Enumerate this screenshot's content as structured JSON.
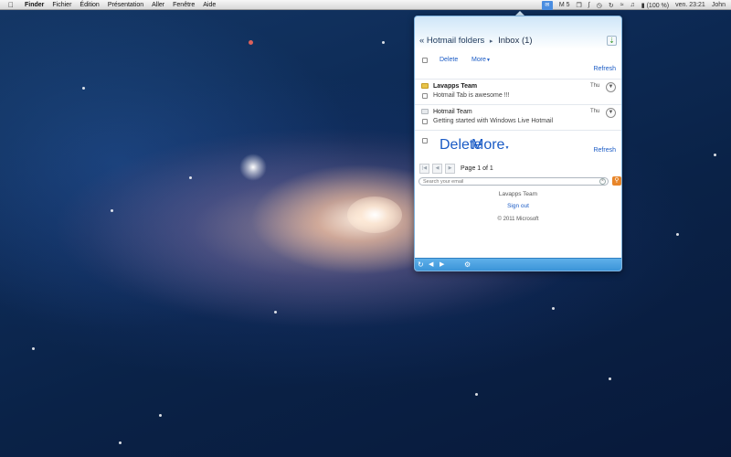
{
  "menubar": {
    "app_name": "Finder",
    "menus": [
      "Fichier",
      "Édition",
      "Présentation",
      "Aller",
      "Fenêtre",
      "Aide"
    ],
    "tray_count": "5",
    "battery": "(100 %)",
    "clock": "ven. 23:21",
    "user": "John"
  },
  "popover": {
    "breadcrumb_back": "« Hotmail folders",
    "breadcrumb_separator": "▸",
    "breadcrumb_current": "Inbox (1)",
    "toolbar": {
      "delete_label": "Delete",
      "more_label": "More",
      "refresh_label": "Refresh"
    },
    "messages": [
      {
        "sender": "Lavapps Team",
        "subject": "Hotmail Tab is awesome !!!",
        "date": "Thu",
        "unread": true
      },
      {
        "sender": "Hotmail Team",
        "subject": "Getting started with Windows Live Hotmail",
        "date": "Thu",
        "unread": false
      }
    ],
    "pager_text": "Page 1 of 1",
    "search_placeholder": "Search your email",
    "account_name": "Lavapps Team",
    "sign_out_label": "Sign out",
    "copyright": "© 2011 Microsoft"
  },
  "colors": {
    "link": "#1a5bc5",
    "footer": "#3b94d8",
    "popover_border": "#7fb3de"
  },
  "icons": [
    "apple-icon",
    "hotmail-tray-icon",
    "download-icon",
    "expand-icon",
    "refresh-icon",
    "back-icon",
    "forward-icon",
    "gear-icon",
    "search-icon"
  ]
}
